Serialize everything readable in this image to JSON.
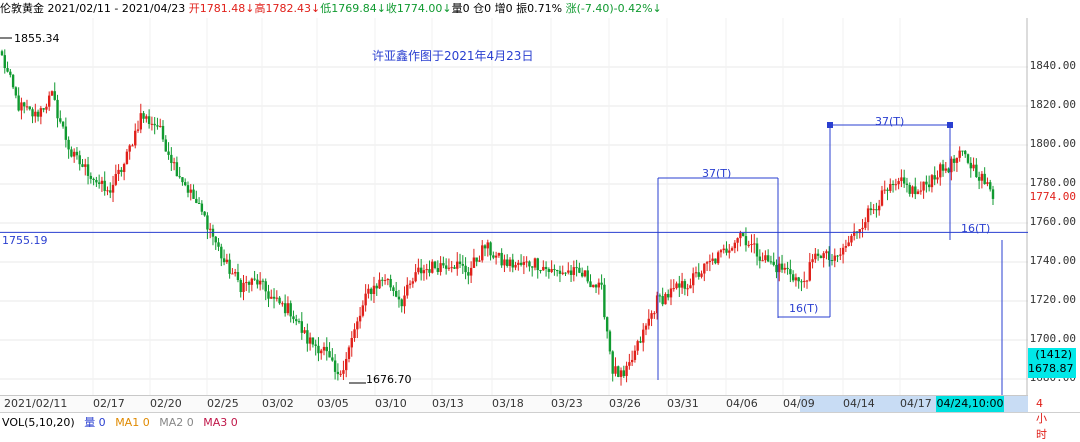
{
  "header": {
    "symbol": "伦敦黄金",
    "range": "2021/02/11 - 2021/04/23",
    "open": "开1781.48↓",
    "high": "高1782.43↓",
    "low": "低1769.84↓",
    "close": "收1774.00↓",
    "volume": "量0",
    "oi": "仓0",
    "oi_change": "增0",
    "amplitude": "振0.71%",
    "change": "涨(-7.40)-0.42%↓"
  },
  "watermark": "许亚鑫作图于2021年4月23日",
  "annotations": {
    "hi_label": "1855.34",
    "lo_label": "1676.70",
    "level_label": "1755.19",
    "cycle_a": "37(T)",
    "cycle_b": "16(T)",
    "cycle_c": "37(T)",
    "cycle_d": "16(T)"
  },
  "price_axis": {
    "ticks": [
      "1840.00",
      "1820.00",
      "1800.00",
      "1780.00",
      "1760.00",
      "1740.00",
      "1720.00",
      "1700.00",
      "1680.00"
    ],
    "last_price": "1774.00",
    "count_box": "(1412)",
    "cursor_price": "1678.87"
  },
  "date_axis": {
    "labels": [
      "2021/02/11",
      "02/17",
      "02/20",
      "02/25",
      "03/02",
      "03/05",
      "03/10",
      "03/13",
      "03/18",
      "03/23",
      "03/26",
      "03/31",
      "04/06",
      "04/09",
      "04/14",
      "04/17"
    ],
    "cursor_time": "04/24,10:00",
    "period": "4小时"
  },
  "volume_bar": {
    "title": "VOL(5,10,20)",
    "vol": "量 0",
    "ma1": "MA1 0",
    "ma2": "MA2 0",
    "ma3": "MA3 0"
  },
  "colors": {
    "up": "#e0201a",
    "down": "#109a30",
    "line": "#2a3fd0",
    "accent": "#00e0e0"
  },
  "chart_data": {
    "type": "candlestick",
    "ylim": [
      1675,
      1858
    ],
    "waypoints": [
      [
        0,
        1845
      ],
      [
        6,
        1820
      ],
      [
        12,
        1815
      ],
      [
        18,
        1825
      ],
      [
        25,
        1795
      ],
      [
        32,
        1785
      ],
      [
        38,
        1775
      ],
      [
        44,
        1790
      ],
      [
        50,
        1815
      ],
      [
        56,
        1810
      ],
      [
        62,
        1790
      ],
      [
        68,
        1775
      ],
      [
        74,
        1760
      ],
      [
        80,
        1740
      ],
      [
        86,
        1728
      ],
      [
        92,
        1730
      ],
      [
        98,
        1720
      ],
      [
        104,
        1715
      ],
      [
        110,
        1700
      ],
      [
        116,
        1695
      ],
      [
        121,
        1680
      ],
      [
        126,
        1700
      ],
      [
        132,
        1725
      ],
      [
        138,
        1732
      ],
      [
        144,
        1720
      ],
      [
        150,
        1735
      ],
      [
        156,
        1738
      ],
      [
        162,
        1740
      ],
      [
        168,
        1735
      ],
      [
        174,
        1748
      ],
      [
        180,
        1740
      ],
      [
        186,
        1738
      ],
      [
        192,
        1740
      ],
      [
        198,
        1735
      ],
      [
        204,
        1735
      ],
      [
        210,
        1733
      ],
      [
        216,
        1725
      ],
      [
        220,
        1685
      ],
      [
        224,
        1680
      ],
      [
        230,
        1700
      ],
      [
        236,
        1720
      ],
      [
        242,
        1725
      ],
      [
        248,
        1730
      ],
      [
        254,
        1738
      ],
      [
        260,
        1745
      ],
      [
        266,
        1755
      ],
      [
        272,
        1745
      ],
      [
        278,
        1738
      ],
      [
        284,
        1735
      ],
      [
        288,
        1728
      ],
      [
        294,
        1745
      ],
      [
        300,
        1740
      ],
      [
        306,
        1752
      ],
      [
        312,
        1765
      ],
      [
        318,
        1775
      ],
      [
        324,
        1780
      ],
      [
        330,
        1775
      ],
      [
        336,
        1785
      ],
      [
        342,
        1790
      ],
      [
        346,
        1795
      ],
      [
        352,
        1785
      ],
      [
        357,
        1774
      ]
    ]
  }
}
